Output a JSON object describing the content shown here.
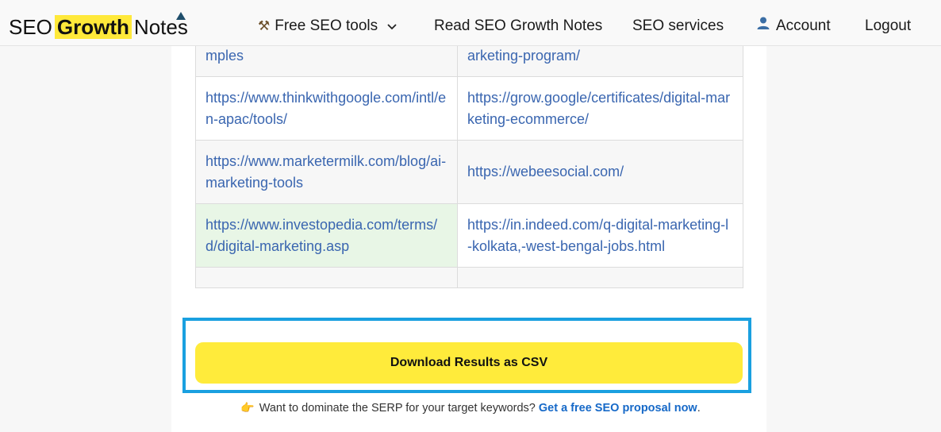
{
  "logo": {
    "word1": "SEO",
    "word2": "Growth",
    "word3": "Notes"
  },
  "nav": {
    "tools_icon": "hammer-wrench-icon",
    "tools_glyph": "⚒",
    "tools_label": "Free SEO tools",
    "read_label": "Read SEO Growth Notes",
    "services_label": "SEO services",
    "account_label": "Account",
    "logout_label": "Logout"
  },
  "table": {
    "rows": [
      [
        "s/marketing-tools-definitions-and-examples",
        "https://www.niit.com/india/course/digital-marketing-program/"
      ],
      [
        "https://www.thinkwithgoogle.com/intl/en-apac/tools/",
        "https://grow.google/certificates/digital-marketing-ecommerce/"
      ],
      [
        "https://www.marketermilk.com/blog/ai-marketing-tools",
        "https://webeesocial.com/"
      ],
      [
        "https://www.investopedia.com/terms/d/digital-marketing.asp",
        "https://in.indeed.com/q-digital-marketing-l-kolkata,-west-bengal-jobs.html"
      ],
      [
        "",
        ""
      ]
    ],
    "highlight_color": "#e8f6e6",
    "link_color": "#3a66b0"
  },
  "download": {
    "label": "Download Results as CSV",
    "button_color": "#ffeb3b",
    "focus_color": "#1aa0e0"
  },
  "cta": {
    "hand_glyph": "👉",
    "text": "Want to dominate the SERP for your target keywords?",
    "link_text": "Get a free SEO proposal now",
    "suffix": "."
  }
}
